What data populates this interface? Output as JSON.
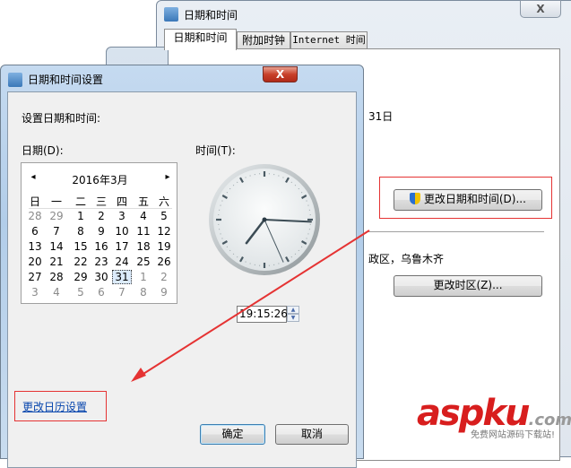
{
  "back_window": {
    "title": "日期和时间",
    "close": "X",
    "tabs": [
      {
        "label": "日期和时间"
      },
      {
        "label": "附加时钟"
      },
      {
        "label": "Internet 时间"
      }
    ],
    "date_text": "31日",
    "change_datetime_button": "更改日期和时间(D)...",
    "timezone_text": "政区，乌鲁木齐",
    "change_timezone_button": "更改时区(Z)..."
  },
  "dialog": {
    "title": "日期和时间设置",
    "close": "X",
    "heading": "设置日期和时间:",
    "date_label": "日期(D):",
    "time_label": "时间(T):",
    "calendar": {
      "prev": "◂",
      "next": "▸",
      "month": "2016年3月",
      "weekdays": [
        "日",
        "一",
        "二",
        "三",
        "四",
        "五",
        "六"
      ],
      "weeks": [
        [
          "28",
          "29",
          "1",
          "2",
          "3",
          "4",
          "5"
        ],
        [
          "6",
          "7",
          "8",
          "9",
          "10",
          "11",
          "12"
        ],
        [
          "13",
          "14",
          "15",
          "16",
          "17",
          "18",
          "19"
        ],
        [
          "20",
          "21",
          "22",
          "23",
          "24",
          "25",
          "26"
        ],
        [
          "27",
          "28",
          "29",
          "30",
          "31",
          "1",
          "2"
        ],
        [
          "3",
          "4",
          "5",
          "6",
          "7",
          "8",
          "9"
        ]
      ],
      "selected": "31"
    },
    "clock": {
      "hour": 19,
      "minute": 15,
      "second": 26
    },
    "time_value": "19:15:26",
    "calendar_settings_link": "更改日历设置",
    "ok_button": "确定",
    "cancel_button": "取消"
  },
  "watermark": {
    "brand": "aspku",
    "tld": ".com",
    "tagline": "免费网站源码下载站!"
  },
  "colors": {
    "annotation_red": "#e53333",
    "link_blue": "#0645ad"
  }
}
